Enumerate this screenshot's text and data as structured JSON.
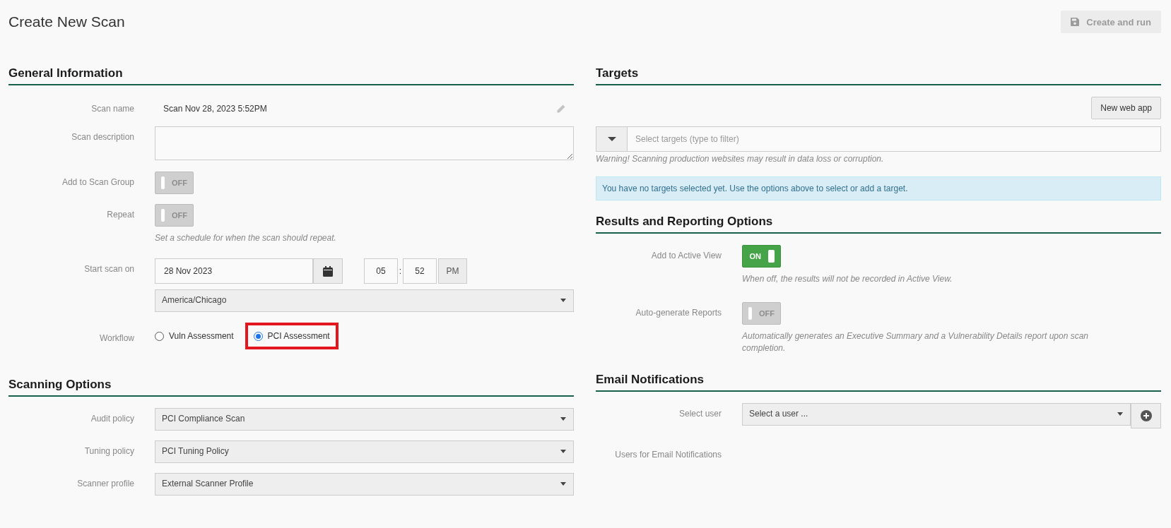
{
  "page": {
    "title": "Create New Scan",
    "primary_button": {
      "label": "Create and run",
      "disabled": true
    }
  },
  "general": {
    "heading": "General Information",
    "scan_name": {
      "label": "Scan name",
      "value": "Scan Nov 28, 2023 5:52PM"
    },
    "scan_description": {
      "label": "Scan description"
    },
    "add_to_group": {
      "label": "Add to Scan Group",
      "on": false,
      "text": "OFF"
    },
    "repeat": {
      "label": "Repeat",
      "on": false,
      "text": "OFF",
      "hint": "Set a schedule for when the scan should repeat."
    },
    "start": {
      "label": "Start scan on",
      "date": "28 Nov 2023",
      "hour": "05",
      "separator": ":",
      "minute": "52",
      "ampm": "PM",
      "timezone": "America/Chicago"
    },
    "workflow": {
      "label": "Workflow",
      "options": [
        {
          "label": "Vuln Assessment",
          "selected": false,
          "highlighted": false
        },
        {
          "label": "PCI Assessment",
          "selected": true,
          "highlighted": true
        }
      ]
    }
  },
  "scanning": {
    "heading": "Scanning Options",
    "selects": [
      {
        "label": "Audit policy",
        "value": "PCI Compliance Scan"
      },
      {
        "label": "Tuning policy",
        "value": "PCI Tuning Policy"
      },
      {
        "label": "Scanner profile",
        "value": "External Scanner Profile"
      }
    ]
  },
  "targets": {
    "heading": "Targets",
    "new_button": "New web app",
    "placeholder": "Select targets (type to filter)",
    "warning": "Warning! Scanning production websites may result in data loss or corruption.",
    "info": "You have no targets selected yet. Use the options above to select or add a target."
  },
  "results": {
    "heading": "Results and Reporting Options",
    "toggles": [
      {
        "label": "Add to Active View",
        "on": true,
        "text": "ON",
        "hint": "When off, the results will not be recorded in Active View."
      },
      {
        "label": "Auto-generate Reports",
        "on": false,
        "text": "OFF",
        "hint": "Automatically generates an Executive Summary and a Vulnerability Details report upon scan completion."
      }
    ]
  },
  "email": {
    "heading": "Email Notifications",
    "select_label": "Select user",
    "select_placeholder": "Select a user ...",
    "users_label": "Users for Email Notifications"
  }
}
